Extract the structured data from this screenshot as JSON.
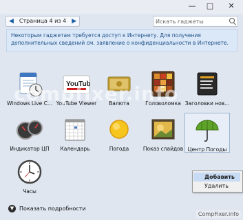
{
  "window": {
    "title": "",
    "controls": [
      "minimize-icon",
      "maximize-icon",
      "close-icon"
    ]
  },
  "nav": {
    "page_label": "Страница 4 из 4",
    "prev_icon": "chevron-left-icon",
    "next_icon": "chevron-right-icon",
    "search_placeholder": "Искать гаджеты"
  },
  "notice": {
    "text": "Некоторым гаджетам требуется доступ к Интернету. Для получения дополнительных сведений см. заявление о конфиденциальности в Интернете."
  },
  "gadgets": [
    {
      "label": "Windows Live C...",
      "icon": "windows-live-contacts-icon"
    },
    {
      "label": "YouTube Viewer",
      "icon": "youtube-icon",
      "logo": "YouTube"
    },
    {
      "label": "Валюта",
      "icon": "currency-icon"
    },
    {
      "label": "Головоломка",
      "icon": "puzzle-icon"
    },
    {
      "label": "Заголовки нов...",
      "icon": "news-headlines-icon"
    },
    {
      "label": "Индикатор ЦП",
      "icon": "cpu-meter-icon"
    },
    {
      "label": "Календарь",
      "icon": "calendar-icon"
    },
    {
      "label": "Погода",
      "icon": "weather-sun-icon"
    },
    {
      "label": "Показ слайдов",
      "icon": "slideshow-icon"
    },
    {
      "label": "Центр Погоды",
      "icon": "weather-center-umbrella-icon",
      "selected": true
    },
    {
      "label": "Часы",
      "icon": "clock-icon"
    }
  ],
  "context_menu": {
    "items": [
      "Добавить",
      "Удалить"
    ],
    "highlighted_index": 0
  },
  "footer": {
    "details_label": "Показать подробности",
    "details_icon": "chevron-down-circle-icon"
  },
  "watermark": {
    "text": "compfixer.info",
    "corner_label": "CompFixer.info"
  },
  "colors": {
    "background": "#dfe6f0",
    "notice_text": "#1f4f86",
    "highlight": "#c7dcf4"
  }
}
